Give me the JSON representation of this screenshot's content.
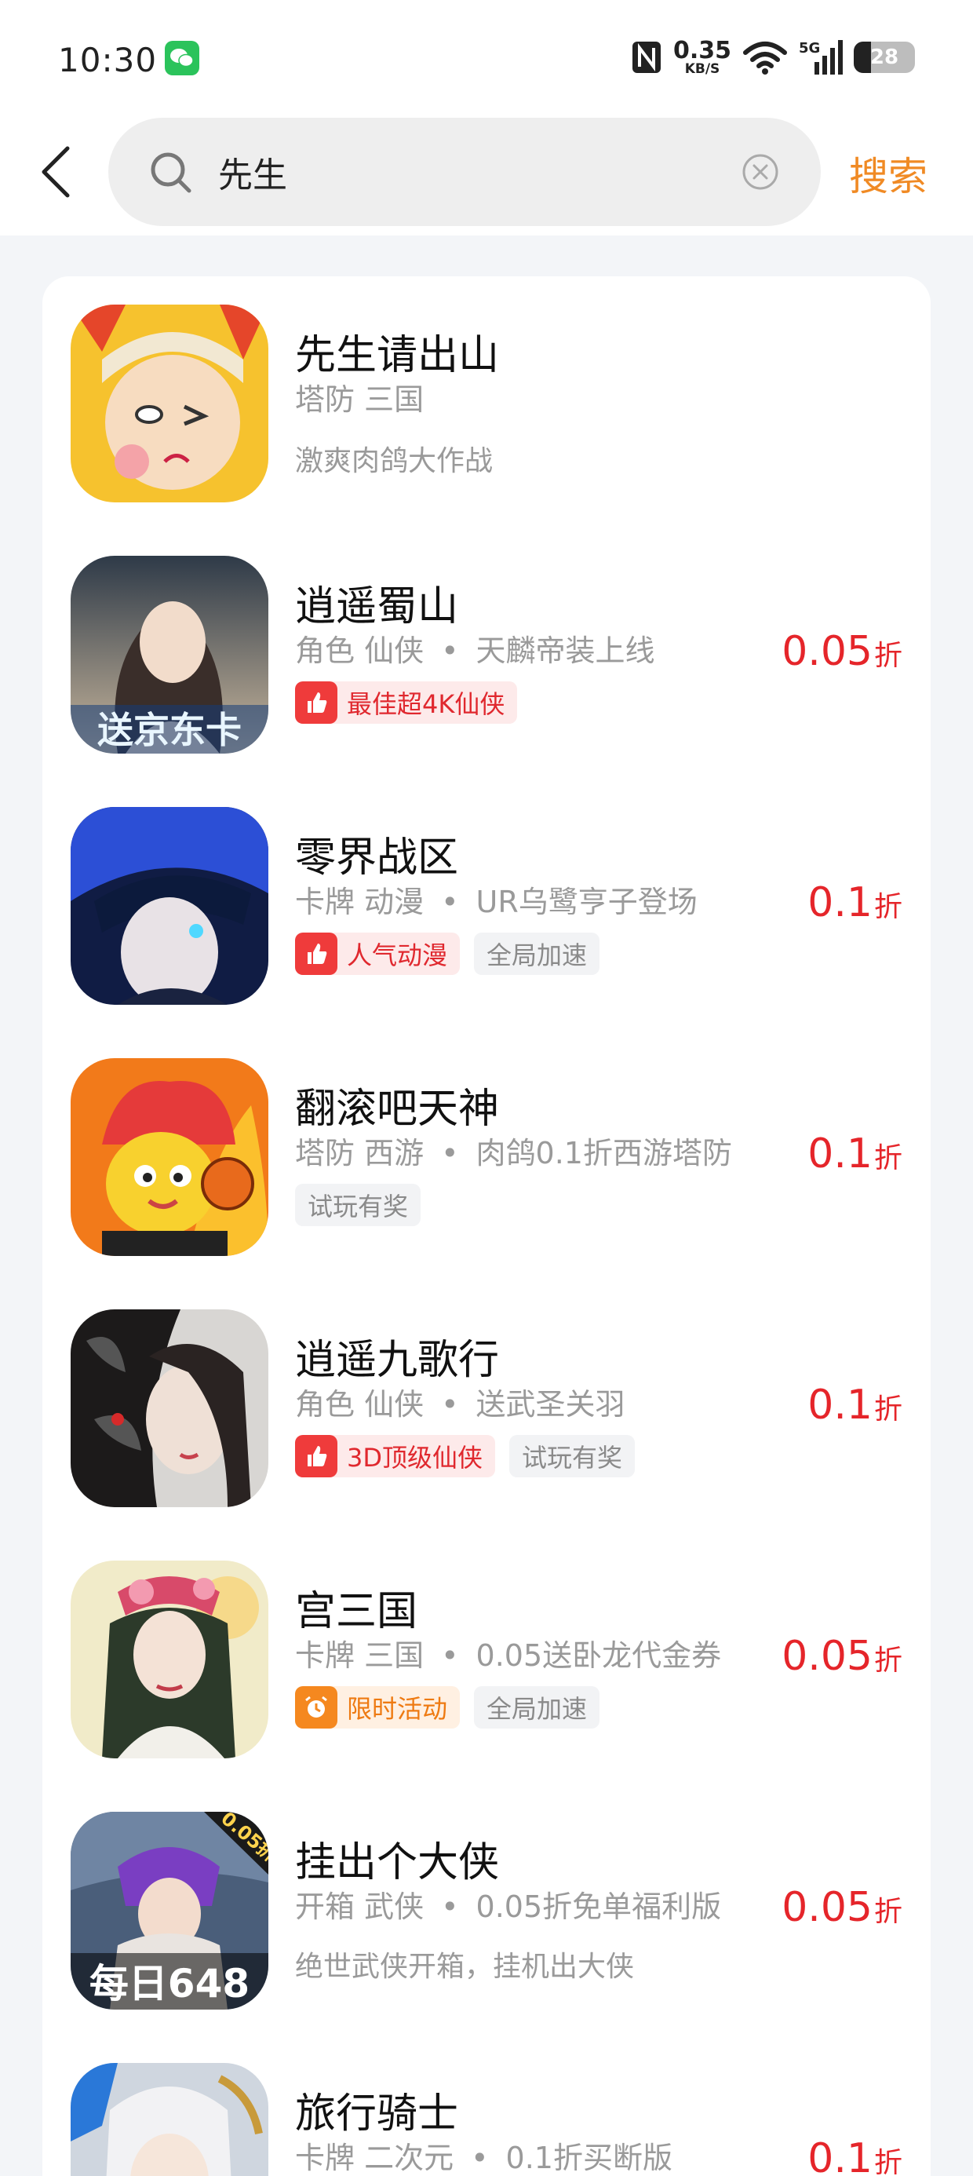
{
  "status_bar": {
    "time": "10:30",
    "speed_value": "0.35",
    "speed_unit": "KB/S",
    "network": "5G",
    "battery": "28",
    "battery_level": 0.28
  },
  "search": {
    "query": "先生",
    "button_label": "搜索"
  },
  "items": [
    {
      "title": "先生请出山",
      "tags": "塔防 三国",
      "note": "",
      "desc": "激爽肉鸽大作战",
      "badges": [],
      "discount": "",
      "discount_unit": ""
    },
    {
      "title": "逍遥蜀山",
      "tags": "角色 仙侠",
      "note": "天麟帝装上线",
      "desc": "",
      "badges": [
        {
          "type": "hot",
          "text": "最佳超4K仙侠"
        }
      ],
      "discount": "0.05",
      "discount_unit": "折",
      "icon_text": "送京东卡"
    },
    {
      "title": "零界战区",
      "tags": "卡牌 动漫",
      "note": "UR乌鹭亨子登场",
      "desc": "",
      "badges": [
        {
          "type": "hot",
          "text": "人气动漫"
        },
        {
          "type": "plain",
          "text": "全局加速"
        }
      ],
      "discount": "0.1",
      "discount_unit": "折"
    },
    {
      "title": "翻滚吧天神",
      "tags": "塔防 西游",
      "note": "肉鸽0.1折西游塔防",
      "desc": "",
      "badges": [
        {
          "type": "plain",
          "text": "试玩有奖"
        }
      ],
      "discount": "0.1",
      "discount_unit": "折"
    },
    {
      "title": "逍遥九歌行",
      "tags": "角色 仙侠",
      "note": "送武圣关羽",
      "desc": "",
      "badges": [
        {
          "type": "hot",
          "text": "3D顶级仙侠"
        },
        {
          "type": "plain",
          "text": "试玩有奖"
        }
      ],
      "discount": "0.1",
      "discount_unit": "折"
    },
    {
      "title": "宫三国",
      "tags": "卡牌 三国",
      "note": "0.05送卧龙代金券",
      "desc": "",
      "badges": [
        {
          "type": "event",
          "text": "限时活动"
        },
        {
          "type": "plain",
          "text": "全局加速"
        }
      ],
      "discount": "0.05",
      "discount_unit": "折"
    },
    {
      "title": "挂出个大侠",
      "tags": "开箱 武侠",
      "note": "0.05折免单福利版",
      "desc": "绝世武侠开箱，挂机出大侠",
      "badges": [],
      "discount": "0.05",
      "discount_unit": "折",
      "icon_text": "每日648",
      "icon_corner": "0.05折"
    },
    {
      "title": "旅行骑士",
      "tags": "卡牌 二次元",
      "note": "0.1折买断版",
      "desc": "",
      "badges": [],
      "discount": "0.1",
      "discount_unit": "折"
    }
  ],
  "colors": {
    "accent": "#f08a24",
    "price": "#e5252a",
    "hot_badge": "#ef3b3b",
    "event_badge": "#f5881f",
    "background": "#f3f5f8"
  },
  "icons": [
    "back-icon",
    "search-icon",
    "clear-icon",
    "wechat-icon",
    "nfc-icon",
    "wifi-icon",
    "signal-icon",
    "thumb-up-icon",
    "alarm-clock-icon"
  ]
}
